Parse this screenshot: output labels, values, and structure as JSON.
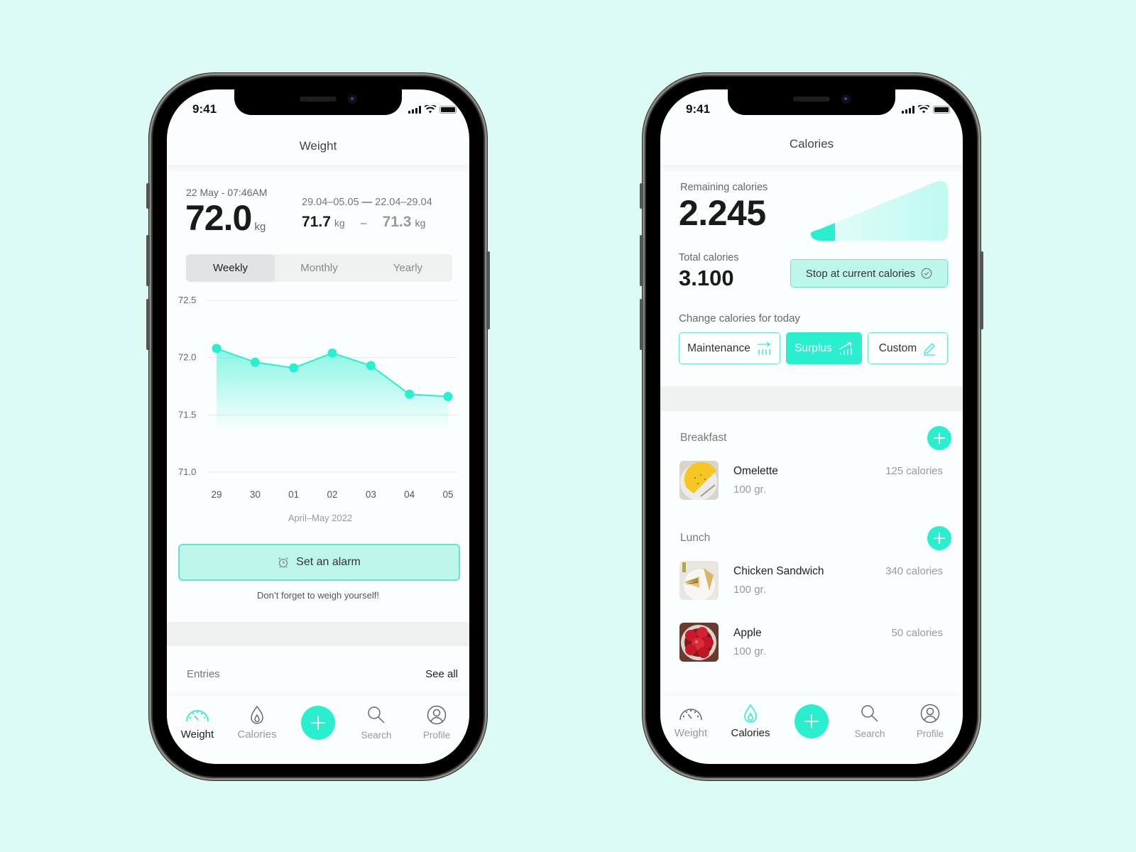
{
  "colors": {
    "accent": "#2aefcf",
    "accent_light": "#bdf7ec",
    "background": "#dcfbf5",
    "text_dark": "#1a1a1a"
  },
  "status_bar": {
    "time": "9:41"
  },
  "weight_screen": {
    "title": "Weight",
    "date_time": "22 May - 07:46AM",
    "current_weight": "72.0",
    "unit": "kg",
    "range_current": "29.04–05.05",
    "range_dash": "—",
    "range_previous": "22.04–29.04",
    "avg_current": "71.7",
    "avg_previous": "71.3",
    "compare_sep": "–",
    "period_tabs": [
      {
        "label": "Weekly",
        "active": true
      },
      {
        "label": "Monthly",
        "active": false
      },
      {
        "label": "Yearly",
        "active": false
      }
    ],
    "alarm_button": {
      "label": "Set an alarm",
      "icon": "alarm-clock-icon"
    },
    "alarm_note": "Don’t forget to weigh yourself!",
    "entries_label": "Entries",
    "see_all": "See all"
  },
  "chart_data": {
    "type": "area",
    "title": "",
    "xlabel": "April–May 2022",
    "ylabel": "",
    "categories": [
      "29",
      "30",
      "01",
      "02",
      "03",
      "04",
      "05"
    ],
    "values": [
      72.08,
      71.96,
      71.91,
      72.04,
      71.93,
      71.68,
      71.66
    ],
    "y_ticks": [
      "72.5",
      "72.0",
      "71.5",
      "71.0"
    ],
    "ylim": [
      71.0,
      72.5
    ],
    "grid": true,
    "legend": "none"
  },
  "calories_screen": {
    "title": "Calories",
    "remaining_label": "Remaining calories",
    "remaining_value": "2.245",
    "remaining_fraction": 0.18,
    "total_label": "Total calories",
    "total_value": "3.100",
    "stop_button": {
      "label": "Stop at current calories",
      "icon": "check-circle-icon"
    },
    "change_label": "Change calories for today",
    "options": [
      {
        "label": "Maintenance",
        "icon": "maintenance-chart-icon",
        "active": false
      },
      {
        "label": "Surplus",
        "icon": "surplus-chart-icon",
        "active": true
      },
      {
        "label": "Custom",
        "icon": "pencil-icon",
        "active": false
      }
    ],
    "meals": [
      {
        "name": "Breakfast",
        "items": [
          {
            "name": "Omelette",
            "qty": "100 gr.",
            "calories": "125 calories",
            "image": "omelette"
          }
        ]
      },
      {
        "name": "Lunch",
        "items": [
          {
            "name": "Chicken Sandwich",
            "qty": "100 gr.",
            "calories": "340 calories",
            "image": "sandwich"
          },
          {
            "name": "Apple",
            "qty": "100 gr.",
            "calories": "50 calories",
            "image": "apple"
          }
        ]
      }
    ]
  },
  "tabbar": {
    "items": [
      {
        "label": "Weight",
        "icon": "scale-gauge-icon"
      },
      {
        "label": "Calories",
        "icon": "flame-icon"
      },
      {
        "label": "",
        "icon": "plus-icon"
      },
      {
        "label": "Search",
        "icon": "search-icon"
      },
      {
        "label": "Profile",
        "icon": "profile-icon"
      }
    ]
  }
}
